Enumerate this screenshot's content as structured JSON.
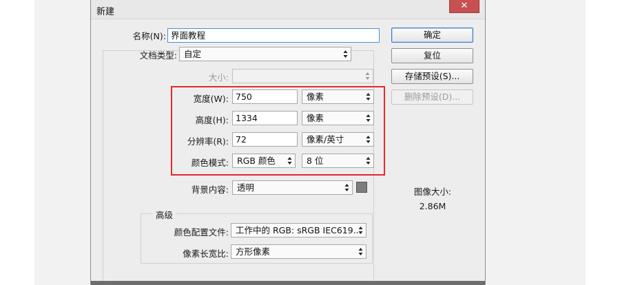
{
  "dialog": {
    "title": "新建",
    "close_label": "✕"
  },
  "form": {
    "name_label": "名称(N):",
    "name_value": "界面教程",
    "doc_type_label": "文档类型:",
    "doc_type_value": "自定",
    "size_label": "大小:",
    "size_value": "",
    "width_label": "宽度(W):",
    "width_value": "750",
    "width_unit": "像素",
    "height_label": "高度(H):",
    "height_value": "1334",
    "height_unit": "像素",
    "resolution_label": "分辨率(R):",
    "resolution_value": "72",
    "resolution_unit": "像素/英寸",
    "color_mode_label": "颜色模式:",
    "color_mode_value": "RGB 颜色",
    "bit_depth_value": "8 位",
    "background_label": "背景内容:",
    "background_value": "透明",
    "background_swatch_color": "#7d7d7d"
  },
  "advanced": {
    "title": "高级",
    "color_profile_label": "颜色配置文件:",
    "color_profile_value": "工作中的 RGB: sRGB IEC619...",
    "pixel_aspect_label": "像素长宽比:",
    "pixel_aspect_value": "方形像素"
  },
  "buttons": {
    "ok": "确定",
    "reset": "复位",
    "save_preset": "存储预设(S)...",
    "delete_preset": "删除预设(D)..."
  },
  "image_size": {
    "label": "图像大小:",
    "value": "2.86M"
  },
  "colors": {
    "highlight": "#e8262e",
    "close_button": "#c75050",
    "default_button_border": "#3d7bc9"
  }
}
